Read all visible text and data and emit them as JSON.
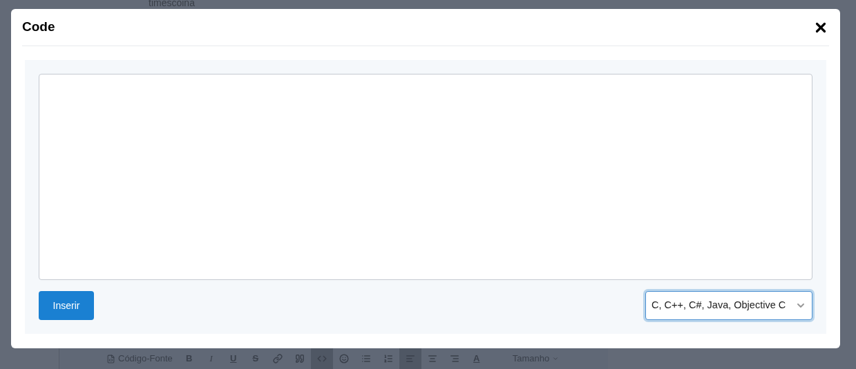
{
  "background_page": {
    "heading_fragment": "timescoina",
    "editor_toolbar": [
      {
        "kind": "source",
        "label": "Código-Fonte",
        "selected": false
      },
      {
        "kind": "bold",
        "label": "B",
        "selected": false
      },
      {
        "kind": "italic",
        "label": "I",
        "selected": false
      },
      {
        "kind": "underline",
        "label": "U",
        "selected": false
      },
      {
        "kind": "strike",
        "label": "S",
        "selected": false
      },
      {
        "kind": "link",
        "selected": false
      },
      {
        "kind": "quote",
        "selected": false
      },
      {
        "kind": "code",
        "selected": true
      },
      {
        "kind": "emoji",
        "selected": false
      },
      {
        "kind": "bullets",
        "selected": false
      },
      {
        "kind": "numbers",
        "selected": false
      },
      {
        "kind": "alignleft",
        "selected": true
      },
      {
        "kind": "aligncenter",
        "selected": false
      },
      {
        "kind": "alignright",
        "selected": false
      },
      {
        "kind": "fontcolor",
        "label": "A",
        "selected": false
      },
      {
        "kind": "size",
        "label": "Tamanho",
        "selected": false
      }
    ]
  },
  "dialog": {
    "title": "Code",
    "insert_button": "Inserir",
    "language_select": {
      "value": "C, C++, C#, Java, Objective C"
    }
  }
}
